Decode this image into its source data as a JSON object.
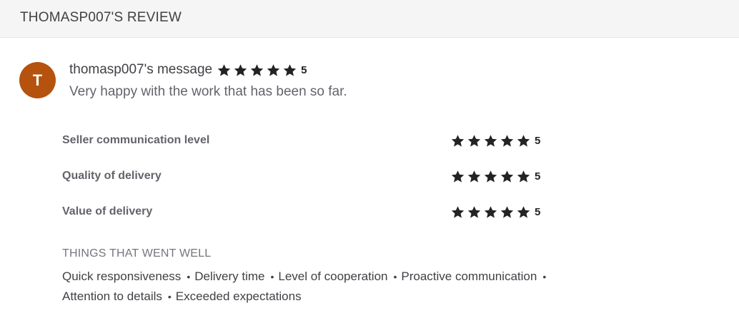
{
  "header": {
    "title": "THOMASP007'S REVIEW"
  },
  "review": {
    "avatar_letter": "T",
    "avatar_color": "#b5520e",
    "title": "thomasp007's message",
    "overall_score": "5",
    "overall_stars_filled": 5,
    "message": "Very happy with the work that has been so far."
  },
  "ratings": [
    {
      "label": "Seller communication level",
      "score": "5",
      "stars_filled": 5
    },
    {
      "label": "Quality of delivery",
      "score": "5",
      "stars_filled": 5
    },
    {
      "label": "Value of delivery",
      "score": "5",
      "stars_filled": 5
    }
  ],
  "things_went_well": {
    "title": "THINGS THAT WENT WELL",
    "items": [
      "Quick responsiveness",
      "Delivery time",
      "Level of cooperation",
      "Proactive communication",
      "Attention to details",
      "Exceeded expectations"
    ]
  },
  "icons": {
    "star": "star-icon",
    "bullet": "•"
  }
}
